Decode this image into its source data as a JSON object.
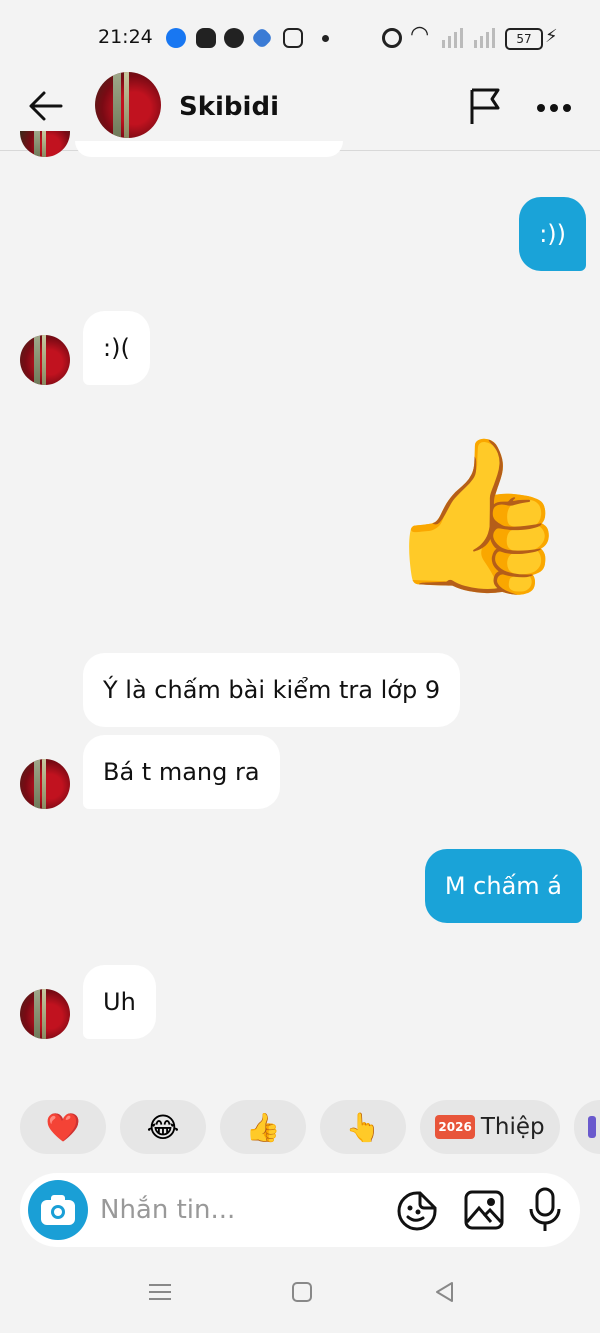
{
  "status_bar": {
    "time": "21:24",
    "battery": "57",
    "icons": [
      "facebook-icon",
      "snapchat-icon",
      "messenger-icon",
      "app-icon",
      "instagram-icon",
      "dot-icon",
      "alarm-icon",
      "wifi-icon",
      "signal-icon",
      "signal-icon",
      "battery-icon",
      "charging-icon"
    ]
  },
  "header": {
    "contact_name": "Skibidi",
    "icons": [
      "back-arrow-icon",
      "flag-icon",
      "more-icon"
    ]
  },
  "messages": [
    {
      "side": "out",
      "text": ":))"
    },
    {
      "side": "in",
      "text": ":)("
    },
    {
      "side": "out",
      "type": "emoji",
      "text": "👍"
    },
    {
      "side": "in",
      "text": "Ý là chấm bài kiểm tra lớp 9"
    },
    {
      "side": "in",
      "text": "Bá t mang ra"
    },
    {
      "side": "out",
      "text": "M chấm á"
    },
    {
      "side": "in",
      "text": "Uh"
    }
  ],
  "reactions": [
    {
      "emoji": "❤️",
      "name": "heart"
    },
    {
      "emoji": "😂",
      "name": "laugh"
    },
    {
      "emoji": "👍",
      "name": "thumbs-up"
    },
    {
      "emoji": "👆",
      "name": "point-up"
    },
    {
      "badge": "2026",
      "label": "Thiệp",
      "name": "card"
    }
  ],
  "composer": {
    "placeholder": "Nhắn tin..."
  },
  "colors": {
    "accent": "#1aa3d8",
    "background": "#f3f3f3",
    "incoming_bubble": "#ffffff"
  }
}
